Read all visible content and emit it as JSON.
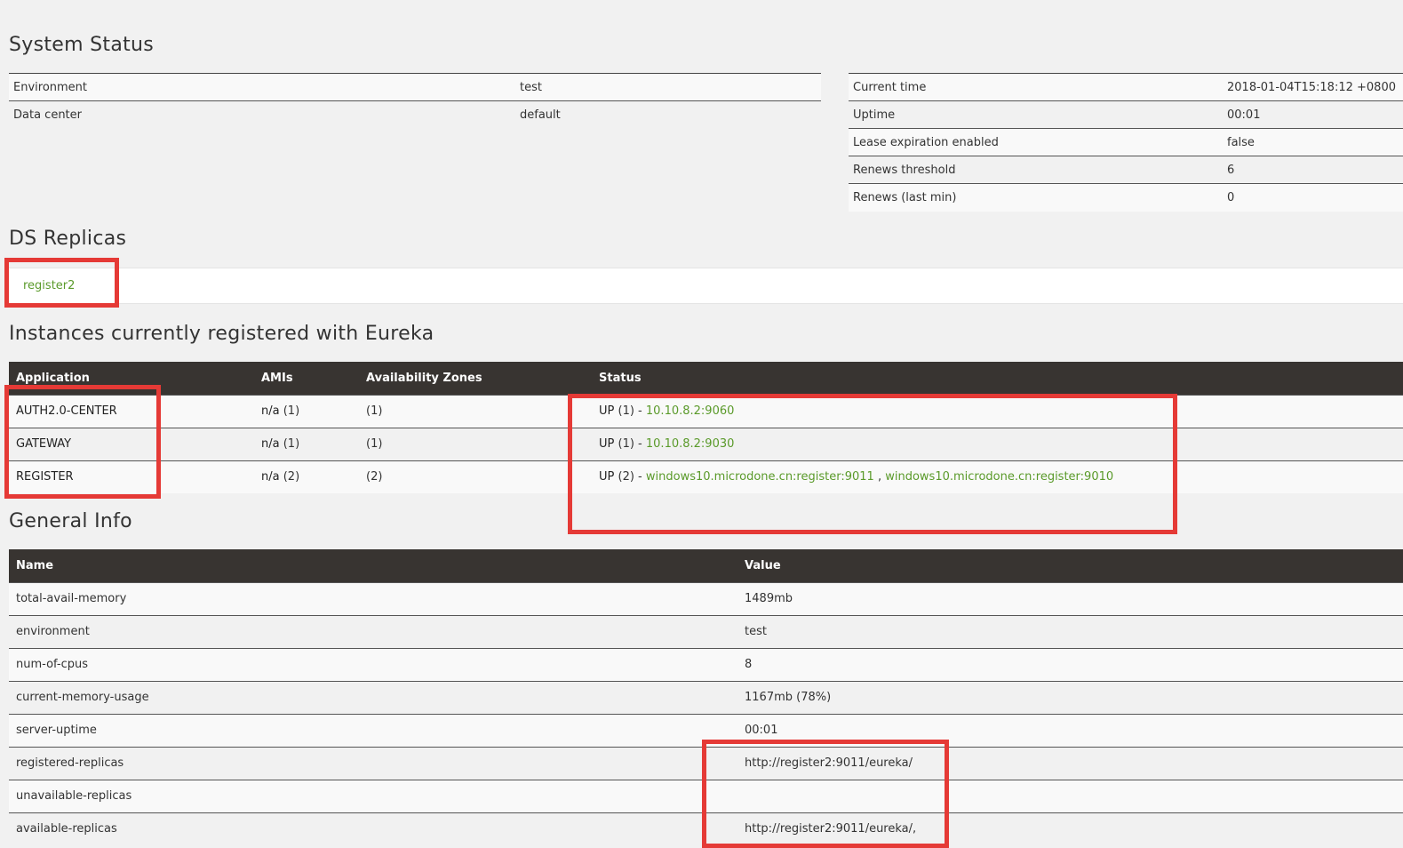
{
  "system_status": {
    "title": "System Status",
    "left": [
      {
        "label": "Environment",
        "value": "test"
      },
      {
        "label": "Data center",
        "value": "default"
      }
    ],
    "right": [
      {
        "label": "Current time",
        "value": "2018-01-04T15:18:12 +0800"
      },
      {
        "label": "Uptime",
        "value": "00:01"
      },
      {
        "label": "Lease expiration enabled",
        "value": "false"
      },
      {
        "label": "Renews threshold",
        "value": "6"
      },
      {
        "label": "Renews (last min)",
        "value": "0"
      }
    ]
  },
  "ds_replicas": {
    "title": "DS Replicas",
    "items": [
      "register2"
    ]
  },
  "instances": {
    "title": "Instances currently registered with Eureka",
    "headers": [
      "Application",
      "AMIs",
      "Availability Zones",
      "Status"
    ],
    "rows": [
      {
        "app": "AUTH2.0-CENTER",
        "amis_main": "n/a",
        "amis_count": "(1)",
        "zones": "(1)",
        "status_main": "UP",
        "status_count": "(1)",
        "sep": " - ",
        "links": [
          "10.10.8.2:9060"
        ]
      },
      {
        "app": "GATEWAY",
        "amis_main": "n/a",
        "amis_count": "(1)",
        "zones": "(1)",
        "status_main": "UP",
        "status_count": "(1)",
        "sep": " - ",
        "links": [
          "10.10.8.2:9030"
        ]
      },
      {
        "app": "REGISTER",
        "amis_main": "n/a",
        "amis_count": "(2)",
        "zones": "(2)",
        "status_main": "UP",
        "status_count": "(2)",
        "sep": " - ",
        "links": [
          "windows10.microdone.cn:register:9011",
          "windows10.microdone.cn:register:9010"
        ],
        "link_sep": " , "
      }
    ]
  },
  "general_info": {
    "title": "General Info",
    "headers": [
      "Name",
      "Value"
    ],
    "rows": [
      {
        "name": "total-avail-memory",
        "value": "1489mb"
      },
      {
        "name": "environment",
        "value": "test"
      },
      {
        "name": "num-of-cpus",
        "value": "8"
      },
      {
        "name": "current-memory-usage",
        "value": "1167mb (78%)"
      },
      {
        "name": "server-uptime",
        "value": "00:01"
      },
      {
        "name": "registered-replicas",
        "value": "http://register2:9011/eureka/"
      },
      {
        "name": "unavailable-replicas",
        "value": ""
      },
      {
        "name": "available-replicas",
        "value": "http://register2:9011/eureka/,"
      }
    ]
  },
  "colors": {
    "link": "#5a9a2a",
    "header_bg": "#383431",
    "highlight": "#e53a36"
  }
}
